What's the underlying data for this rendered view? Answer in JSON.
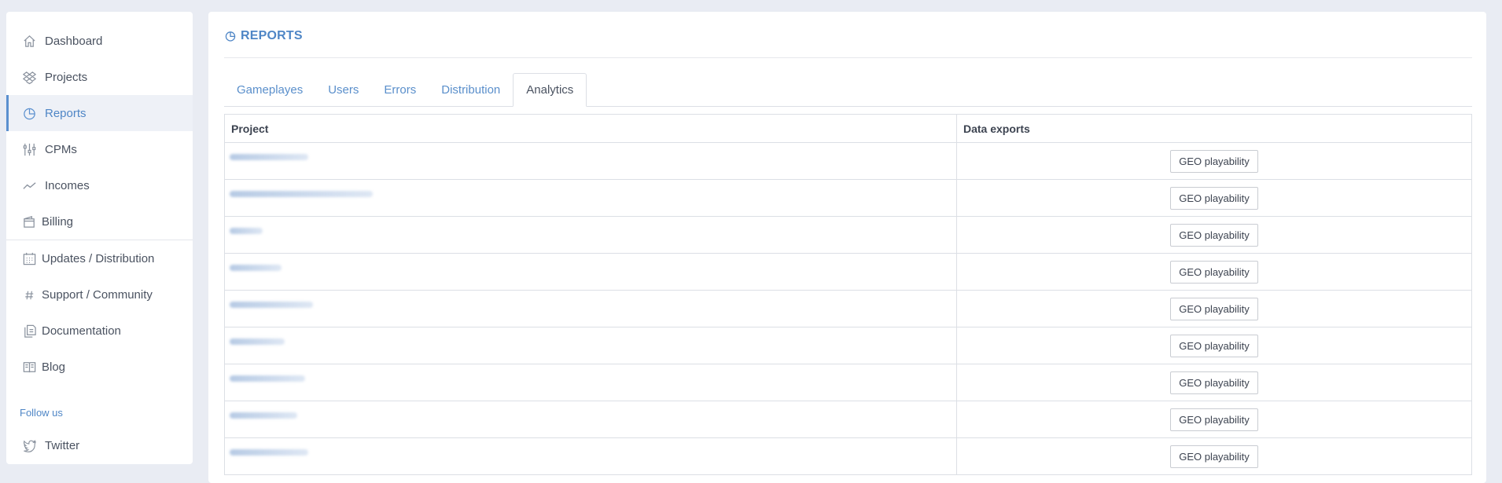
{
  "sidebar": {
    "items": [
      {
        "label": "Dashboard",
        "icon": "home-icon"
      },
      {
        "label": "Projects",
        "icon": "dropbox-icon"
      },
      {
        "label": "Reports",
        "icon": "pie-chart-icon",
        "active": true
      },
      {
        "label": "CPMs",
        "icon": "sliders-icon"
      },
      {
        "label": "Incomes",
        "icon": "trend-line-icon"
      },
      {
        "label": "Billing",
        "icon": "wallet-icon"
      }
    ],
    "secondary_items": [
      {
        "label": "Updates / Distribution",
        "icon": "calendar-icon"
      },
      {
        "label": "Support / Community",
        "icon": "hash-icon"
      },
      {
        "label": "Documentation",
        "icon": "documents-icon"
      },
      {
        "label": "Blog",
        "icon": "book-icon"
      }
    ],
    "follow_us": "Follow us",
    "twitter": "Twitter"
  },
  "page": {
    "title": "REPORTS",
    "accent_color": "#4f86c6"
  },
  "tabs": [
    {
      "label": "Gameplayes"
    },
    {
      "label": "Users"
    },
    {
      "label": "Errors"
    },
    {
      "label": "Distribution"
    },
    {
      "label": "Analytics",
      "active": true
    }
  ],
  "table": {
    "headers": {
      "project": "Project",
      "exports": "Data exports"
    },
    "rows": [
      {
        "project_blur_width": 100,
        "button": "GEO playability"
      },
      {
        "project_blur_width": 182,
        "button": "GEO playability"
      },
      {
        "project_blur_width": 42,
        "button": "GEO playability"
      },
      {
        "project_blur_width": 66,
        "button": "GEO playability"
      },
      {
        "project_blur_width": 106,
        "button": "GEO playability"
      },
      {
        "project_blur_width": 70,
        "button": "GEO playability"
      },
      {
        "project_blur_width": 96,
        "button": "GEO playability"
      },
      {
        "project_blur_width": 86,
        "button": "GEO playability"
      },
      {
        "project_blur_width": 100,
        "button": "GEO playability"
      }
    ]
  }
}
